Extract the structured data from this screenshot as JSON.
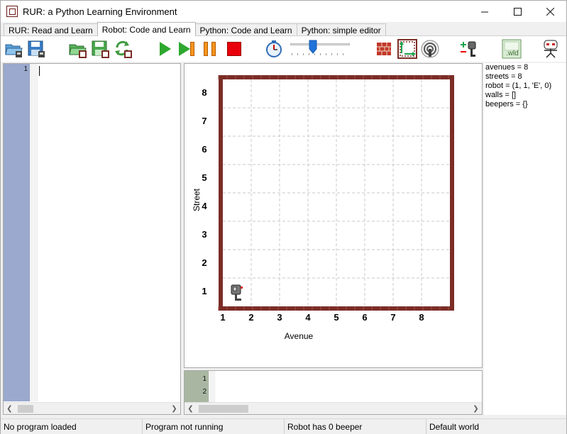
{
  "window": {
    "title": "RUR: a Python Learning Environment",
    "minimize": "—",
    "maximize": "☐",
    "close": "✕"
  },
  "tabs": [
    {
      "label": "RUR: Read and Learn",
      "active": false
    },
    {
      "label": "Robot: Code and Learn",
      "active": true
    },
    {
      "label": "Python: Code and Learn",
      "active": false
    },
    {
      "label": "Python: simple editor",
      "active": false
    }
  ],
  "toolbar": {
    "icons": [
      "open-program-icon",
      "save-program-icon",
      "open-world-icon",
      "save-world-icon",
      "reload-world-icon",
      "run-icon",
      "step-icon",
      "pause-icon",
      "stop-icon",
      "timer-icon",
      "speed-slider",
      "walls-icon",
      "resize-world-icon",
      "beepers-icon",
      "add-robot-icon",
      "world-file-icon",
      "robot-face-icon"
    ],
    "world_file_label": ".wld",
    "speed": 0.35
  },
  "editor": {
    "line_numbers": [
      "1"
    ],
    "content": ""
  },
  "output": {
    "line_numbers": [
      "1",
      "2"
    ]
  },
  "world": {
    "avenues": 8,
    "streets": 8,
    "robot": {
      "avenue": 1,
      "street": 1,
      "orientation": "E",
      "beepers": 0
    },
    "xlabel": "Avenue",
    "ylabel": "Street",
    "ticks": [
      "1",
      "2",
      "3",
      "4",
      "5",
      "6",
      "7",
      "8"
    ],
    "wall_color": "#7b2d26",
    "grid_color": "#c8c8c8"
  },
  "info": {
    "lines": [
      "avenues = 8",
      "streets = 8",
      "robot = (1, 1, 'E', 0)",
      "walls = []",
      "beepers = {}"
    ]
  },
  "status": {
    "program": "No program loaded",
    "running": "Program not running",
    "beepers": "Robot has 0 beeper",
    "world": "Default world"
  }
}
